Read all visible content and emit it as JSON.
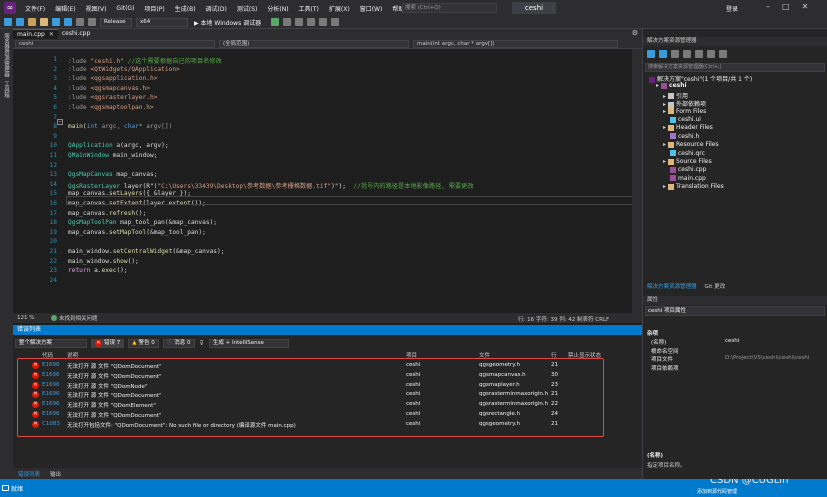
{
  "menubar": {
    "items": [
      "文件(F)",
      "编辑(E)",
      "视图(V)",
      "Git(G)",
      "项目(P)",
      "生成(B)",
      "调试(D)",
      "测试(S)",
      "分析(N)",
      "工具(T)",
      "扩展(X)",
      "窗口(W)",
      "帮助(H)"
    ],
    "search_placeholder": "搜索 (Ctrl+Q)",
    "project_title": "ceshi",
    "login": "登录"
  },
  "toolbar": {
    "config": "Release",
    "platform": "x64",
    "run_label": "▶ 本地 Windows 调试器"
  },
  "left_strip": [
    "服务器资源管理器",
    "工具箱"
  ],
  "editor_tabs": [
    {
      "label": "main.cpp",
      "active": true
    },
    {
      "label": "ceshi.cpp",
      "active": false
    }
  ],
  "navbar": {
    "project": "ceshi",
    "scope": "(全局范围)",
    "func": "main(int argc, char * argv[])"
  },
  "code_lines": [
    {
      "n": "1",
      "parts": [
        {
          "t": ":lude ",
          "c": "#9b9b9b"
        },
        {
          "t": "\"ceshi.h\"",
          "c": "#d69d85"
        },
        {
          "t": " //这个需要根据自己的项目名修改",
          "c": "#57a64a"
        }
      ]
    },
    {
      "n": "2",
      "parts": [
        {
          "t": ":lude ",
          "c": "#9b9b9b"
        },
        {
          "t": "<QtWidgets/QApplication>",
          "c": "#d69d85"
        }
      ]
    },
    {
      "n": "3",
      "parts": [
        {
          "t": ":lude ",
          "c": "#9b9b9b"
        },
        {
          "t": "<qgsapplication.h>",
          "c": "#d69d85"
        }
      ]
    },
    {
      "n": "4",
      "parts": [
        {
          "t": ":lude ",
          "c": "#9b9b9b"
        },
        {
          "t": "<qgsmapcanvas.h>",
          "c": "#d69d85"
        }
      ]
    },
    {
      "n": "5",
      "parts": [
        {
          "t": ":lude ",
          "c": "#9b9b9b"
        },
        {
          "t": "<qgsrasterlayer.h>",
          "c": "#d69d85"
        }
      ]
    },
    {
      "n": "6",
      "parts": [
        {
          "t": ":lude ",
          "c": "#9b9b9b"
        },
        {
          "t": "<qgsmaptoolpan.h>",
          "c": "#d69d85"
        }
      ]
    },
    {
      "n": "7",
      "parts": []
    },
    {
      "n": "8",
      "parts": [
        {
          "t": "main",
          "c": "#dcdcaa"
        },
        {
          "t": "(",
          "c": "#dcdcdc"
        },
        {
          "t": "int",
          "c": "#569cd6"
        },
        {
          "t": " argc, ",
          "c": "#9a9a9a"
        },
        {
          "t": "char",
          "c": "#569cd6"
        },
        {
          "t": "* argv[])",
          "c": "#9a9a9a"
        }
      ]
    },
    {
      "n": "9",
      "parts": []
    },
    {
      "n": "10",
      "parts": [
        {
          "t": "QApplication",
          "c": "#4ec9b0"
        },
        {
          "t": " a(argc, argv);",
          "c": "#dcdcdc"
        }
      ]
    },
    {
      "n": "11",
      "parts": [
        {
          "t": "QMainWindow",
          "c": "#4ec9b0"
        },
        {
          "t": " main_window;",
          "c": "#dcdcdc"
        }
      ]
    },
    {
      "n": "12",
      "parts": []
    },
    {
      "n": "13",
      "parts": [
        {
          "t": "QgsMapCanvas",
          "c": "#4ec9b0"
        },
        {
          "t": " map_canvas;",
          "c": "#dcdcdc"
        }
      ]
    },
    {
      "n": "14",
      "parts": [
        {
          "t": "QgsRasterLayer",
          "c": "#4ec9b0"
        },
        {
          "t": " layer(R\"(",
          "c": "#dcdcdc"
        },
        {
          "t": "\"C:\\Users\\33439\\Desktop\\参考数据\\参考栅格数据.tif\"",
          "c": "#d69d85"
        },
        {
          "t": ")\");  ",
          "c": "#dcdcdc"
        },
        {
          "t": "//括号内的路径是本地影像路径, 需要更改",
          "c": "#57a64a"
        }
      ]
    },
    {
      "n": "15",
      "parts": [
        {
          "t": "map_canvas.",
          "c": "#dcdcdc"
        },
        {
          "t": "setLayers",
          "c": "#dcdcaa"
        },
        {
          "t": "({ &layer });",
          "c": "#dcdcdc"
        }
      ]
    },
    {
      "n": "16",
      "parts": [
        {
          "t": "map_canvas.",
          "c": "#dcdcdc"
        },
        {
          "t": "setExtent",
          "c": "#dcdcaa"
        },
        {
          "t": "(layer.",
          "c": "#dcdcdc"
        },
        {
          "t": "extent",
          "c": "#dcdcaa"
        },
        {
          "t": "());",
          "c": "#dcdcdc"
        }
      ]
    },
    {
      "n": "17",
      "parts": [
        {
          "t": "map_canvas.",
          "c": "#dcdcdc"
        },
        {
          "t": "refresh",
          "c": "#dcdcaa"
        },
        {
          "t": "();",
          "c": "#dcdcdc"
        }
      ]
    },
    {
      "n": "18",
      "parts": [
        {
          "t": "QgsMapToolPan",
          "c": "#4ec9b0"
        },
        {
          "t": " map_tool_pan(&map_canvas);",
          "c": "#dcdcdc"
        }
      ]
    },
    {
      "n": "19",
      "parts": [
        {
          "t": "map_canvas.",
          "c": "#dcdcdc"
        },
        {
          "t": "setMapTool",
          "c": "#dcdcaa"
        },
        {
          "t": "(&map_tool_pan);",
          "c": "#dcdcdc"
        }
      ]
    },
    {
      "n": "20",
      "parts": []
    },
    {
      "n": "21",
      "parts": [
        {
          "t": "main_window.",
          "c": "#dcdcdc"
        },
        {
          "t": "setCentralWidget",
          "c": "#dcdcaa"
        },
        {
          "t": "(&map_canvas);",
          "c": "#dcdcdc"
        }
      ]
    },
    {
      "n": "22",
      "parts": [
        {
          "t": "main_window.",
          "c": "#dcdcdc"
        },
        {
          "t": "show",
          "c": "#dcdcaa"
        },
        {
          "t": "();",
          "c": "#dcdcdc"
        }
      ]
    },
    {
      "n": "23",
      "parts": [
        {
          "t": "return",
          "c": "#d8a0df"
        },
        {
          "t": " a.",
          "c": "#dcdcdc"
        },
        {
          "t": "exec",
          "c": "#dcdcaa"
        },
        {
          "t": "();",
          "c": "#dcdcdc"
        }
      ]
    },
    {
      "n": "24",
      "parts": []
    }
  ],
  "editor_status": {
    "zoom": "121 %",
    "issues": "未找到相关问题",
    "position": "行: 16   字符: 39   列: 42   制表符   CRLF"
  },
  "error_panel": {
    "title": "错误列表",
    "scope": "整个解决方案",
    "errors_btn": "错误 7",
    "warnings_btn": "警告 0",
    "messages_btn": "消息 0",
    "build_filter": "生成 + IntelliSense",
    "search_placeholder": "搜索错误列表",
    "columns": [
      "代码",
      "说明",
      "项目",
      "文件",
      "行",
      "禁止显示状态"
    ],
    "rows": [
      {
        "code": "E1696",
        "desc": "无法打开 源 文件 \"QDomDocument\"",
        "project": "ceshi",
        "file": "qgsgeometry.h",
        "line": "21"
      },
      {
        "code": "E1696",
        "desc": "无法打开 源 文件 \"QDomDocument\"",
        "project": "ceshi",
        "file": "qgsmapcanvas.h",
        "line": "30"
      },
      {
        "code": "E1696",
        "desc": "无法打开 源 文件 \"QDomNode\"",
        "project": "ceshi",
        "file": "qgsmaplayer.h",
        "line": "23"
      },
      {
        "code": "E1696",
        "desc": "无法打开 源 文件 \"QDomDocument\"",
        "project": "ceshi",
        "file": "qgsrasterminmaxorigin.h",
        "line": "21"
      },
      {
        "code": "E1696",
        "desc": "无法打开 源 文件 \"QDomElement\"",
        "project": "ceshi",
        "file": "qgsrasterminmaxorigin.h",
        "line": "22"
      },
      {
        "code": "E1696",
        "desc": "无法打开 源 文件 \"QDomDocument\"",
        "project": "ceshi",
        "file": "qgsrectangle.h",
        "line": "24"
      },
      {
        "code": "C1083",
        "desc": "无法打开包括文件: \"QDomDocument\": No such file or directory (编译源文件 main.cpp)",
        "project": "ceshi",
        "file": "qgsgeometry.h",
        "line": "21"
      }
    ]
  },
  "bottom_tabs": [
    "错误列表",
    "输出"
  ],
  "statusbar": {
    "ready": "就绪",
    "add_source": "添加到源代码管理",
    "watermark": "CSDN @CUGLin"
  },
  "solution_explorer": {
    "title": "解决方案资源管理器",
    "search_placeholder": "搜索解决方案资源管理器(Ctrl+;)",
    "items": [
      {
        "label": "解决方案\"ceshi\"(1 个项目/共 1 个)",
        "indent": 0,
        "icon": "#68217a"
      },
      {
        "label": "ceshi",
        "indent": 1,
        "icon": "#9b4f96"
      },
      {
        "label": "引用",
        "indent": 2,
        "icon": "#c5c5c5"
      },
      {
        "label": "外部依赖项",
        "indent": 2,
        "icon": "#c5c5c5"
      },
      {
        "label": "Form Files",
        "indent": 2,
        "icon": "#dcb67a"
      },
      {
        "label": "ceshi.ui",
        "indent": 3,
        "icon": "#4fc1e9"
      },
      {
        "label": "Header Files",
        "indent": 2,
        "icon": "#dcb67a"
      },
      {
        "label": "ceshi.h",
        "indent": 3,
        "icon": "#a074c4"
      },
      {
        "label": "Resource Files",
        "indent": 2,
        "icon": "#dcb67a"
      },
      {
        "label": "ceshi.qrc",
        "indent": 3,
        "icon": "#4fc1e9"
      },
      {
        "label": "Source Files",
        "indent": 2,
        "icon": "#dcb67a"
      },
      {
        "label": "ceshi.cpp",
        "indent": 3,
        "icon": "#9b4f96"
      },
      {
        "label": "main.cpp",
        "indent": 3,
        "icon": "#9b4f96"
      },
      {
        "label": "Translation Files",
        "indent": 2,
        "icon": "#dcb67a"
      }
    ],
    "tabs": [
      "解决方案资源管理器",
      "Git 更改"
    ]
  },
  "properties": {
    "title": "属性",
    "object": "ceshi 项目属性",
    "section": "杂项",
    "rows": [
      {
        "k": "(名称)",
        "v": "ceshi"
      },
      {
        "k": "根命名空间",
        "v": ""
      },
      {
        "k": "项目文件",
        "v": "D:\\Project\\VS\\ceshi\\ceshi\\ceshi"
      },
      {
        "k": "项目依赖项",
        "v": ""
      }
    ],
    "desc_title": "(名称)",
    "desc_text": "指定项目名称。"
  }
}
